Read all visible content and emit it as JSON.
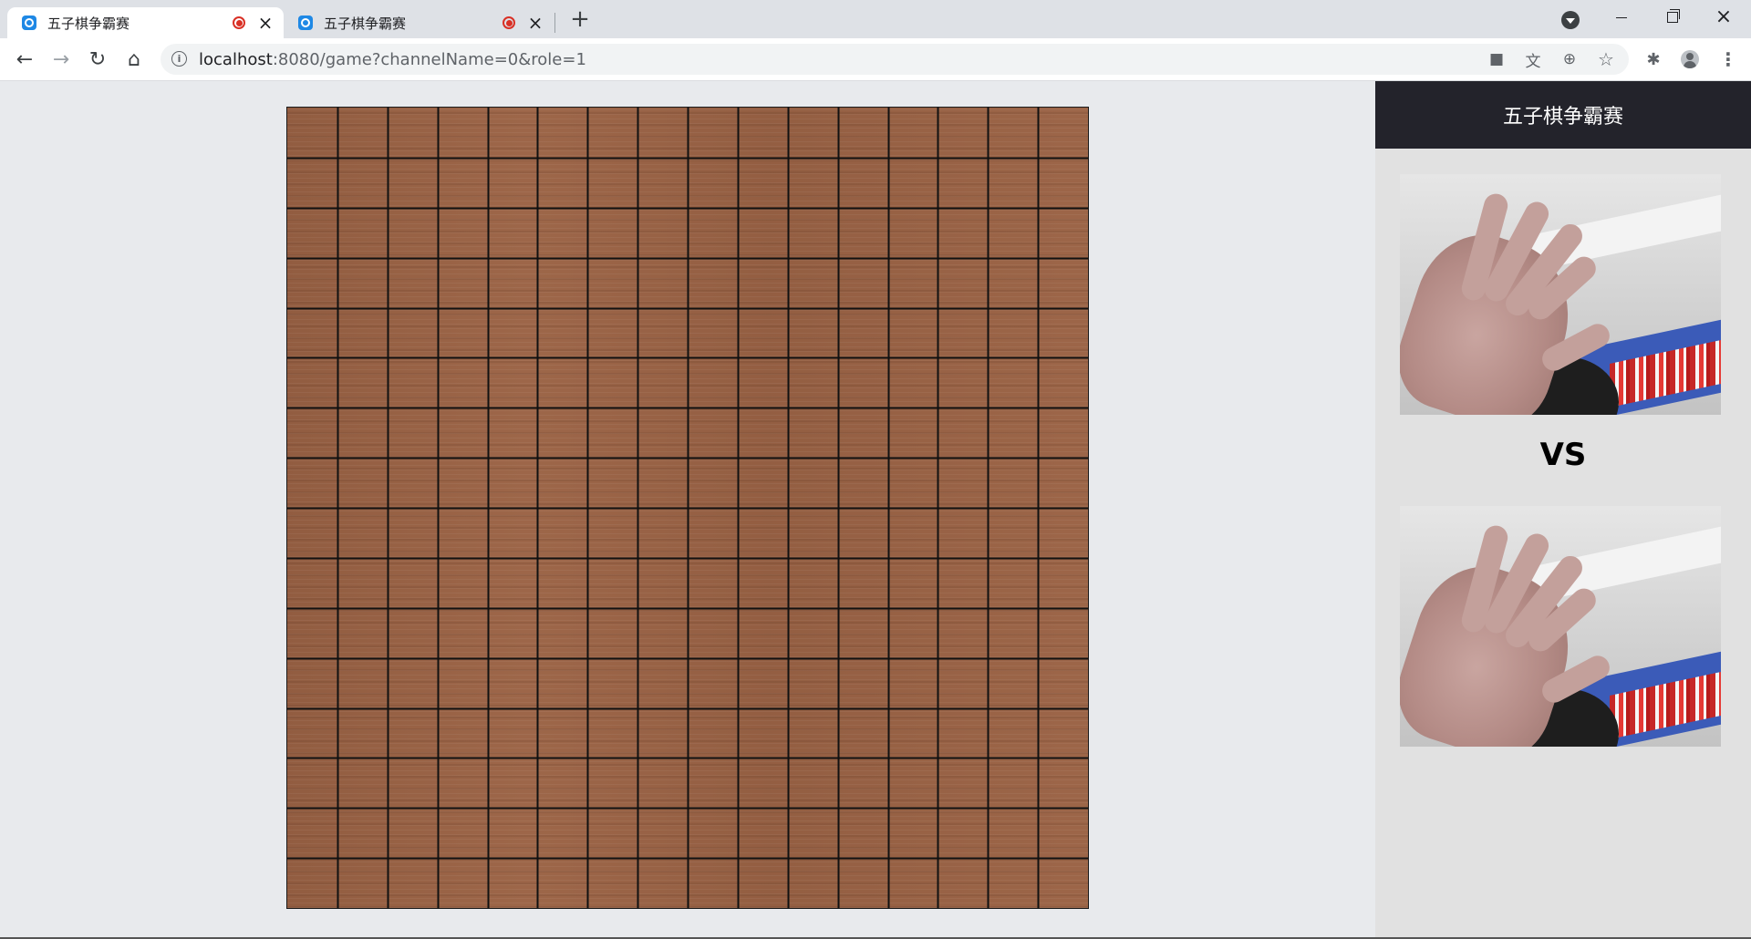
{
  "browser": {
    "tabs": [
      {
        "title": "五子棋争霸赛",
        "active": true
      },
      {
        "title": "五子棋争霸赛",
        "active": false
      }
    ],
    "new_tab_label": "+",
    "address_url_host": "localhost",
    "address_url_rest": ":8080/game?channelName=0&role=1",
    "icons": {
      "back": "←",
      "forward": "→",
      "reload": "↻",
      "home": "⌂",
      "info": "i",
      "camera": "■",
      "translate": "文",
      "zoom": "⊕",
      "star": "☆",
      "extensions": "✱",
      "menu": "⋮",
      "close": "×"
    }
  },
  "board": {
    "size": 16,
    "line_color": "#111111",
    "stones": []
  },
  "sidebar": {
    "title": "五子棋争霸赛",
    "vs_label": "VS"
  }
}
